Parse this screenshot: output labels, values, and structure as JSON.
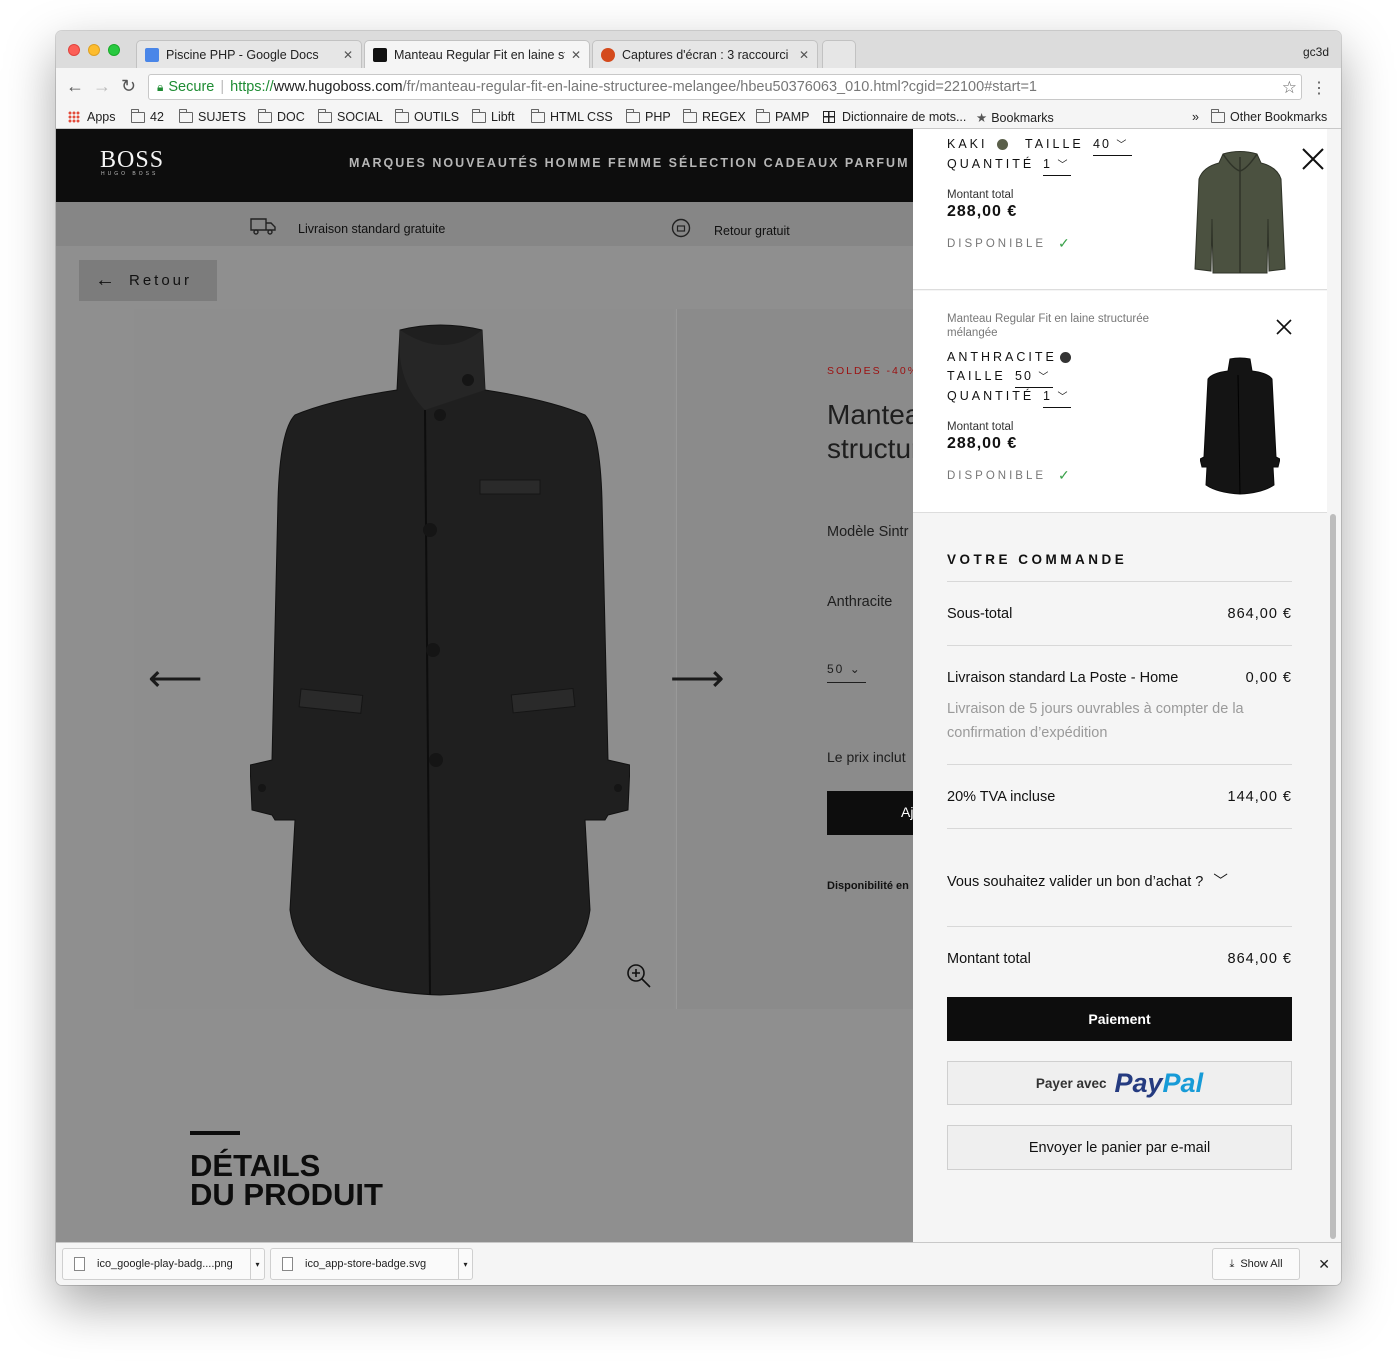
{
  "browser": {
    "tabs": [
      {
        "title": "Piscine PHP - Google Docs",
        "favicon_color": "#4a86e8"
      },
      {
        "title": "Manteau Regular Fit en laine st",
        "favicon_color": "#111111"
      },
      {
        "title": "Captures d'écran : 3 raccourci",
        "favicon_color": "#d44a1c"
      }
    ],
    "profile": "gc3d",
    "secure_label": "Secure",
    "url_scheme": "https://",
    "url_host": "www.hugoboss.com",
    "url_path": "/fr/manteau-regular-fit-en-laine-structuree-melangee/hbeu50376063_010.html?cgid=22100#start=1",
    "bookmarks": [
      "Apps",
      "42",
      "SUJETS",
      "DOC",
      "SOCIAL",
      "OUTILS",
      "Libft",
      "HTML CSS",
      "PHP",
      "REGEX",
      "PAMP",
      "Dictionnaire de mots...",
      "Bookmarks"
    ],
    "other_bookmarks": "Other Bookmarks",
    "bookmarks_overflow": "»"
  },
  "site": {
    "logo": "BOSS",
    "logo_sub": "HUGO BOSS",
    "nav": "MARQUES NOUVEAUTÉS HOMME FEMME SÉLECTION CADEAUX PARFUM",
    "benefit_1": "Livraison standard gratuite",
    "benefit_2": "Retour gratuit",
    "back": "Retour",
    "soldes": "SOLDES -40%",
    "product_name": "Manteau Regular Fit en laine structurée mélangée",
    "product_model": "Modèle Sintr",
    "product_color": "Anthracite",
    "product_size": "50",
    "price_note": "Le prix inclut",
    "add_btn": "Aj",
    "availability": "Disponibilité en",
    "details_title_1": "DÉTAILS",
    "details_title_2": "DU PRODUIT"
  },
  "cart": {
    "item1": {
      "color_label": "KAKI",
      "color_hex": "#5a5f4a",
      "size_label": "TAILLE",
      "size": "40",
      "qty_label": "QUANTITÉ",
      "qty": "1",
      "total_label": "Montant total",
      "total": "288,00 €",
      "status": "DISPONIBLE"
    },
    "item2": {
      "name": "Manteau Regular Fit en laine structurée mélangée",
      "color_label": "ANTHRACITE",
      "color_hex": "#333333",
      "size_label": "TAILLE",
      "size": "50",
      "qty_label": "QUANTITÉ",
      "qty": "1",
      "total_label": "Montant total",
      "total": "288,00 €",
      "status": "DISPONIBLE"
    },
    "order_title": "VOTRE COMMANDE",
    "subtotal_label": "Sous-total",
    "subtotal": "864,00 €",
    "shipping_label": "Livraison standard La Poste - Home",
    "shipping": "0,00 €",
    "shipping_note": "Livraison de 5 jours ouvrables à compter de la confirmation d’expédition",
    "vat_label": "20% TVA incluse",
    "vat": "144,00 €",
    "voucher_label": "Vous souhaitez valider un bon d’achat ?",
    "total_label": "Montant total",
    "total": "864,00 €",
    "pay_btn": "Paiement",
    "paypal_prefix": "Payer avec",
    "paypal_1": "Pay",
    "paypal_2": "Pal",
    "mail_btn": "Envoyer le panier par e-mail"
  },
  "downloads": {
    "file_1": "ico_google-play-badg....png",
    "file_2": "ico_app-store-badge.svg",
    "show_all": "Show All"
  }
}
